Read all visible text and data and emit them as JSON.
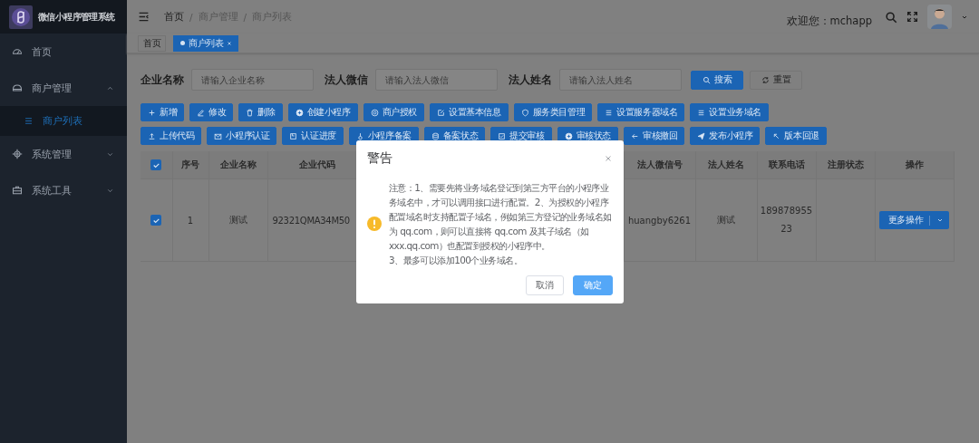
{
  "sidebar": {
    "title": "微信小程序管理系统",
    "items": [
      {
        "label": "首页",
        "selected": false
      },
      {
        "label": "商户管理",
        "selected": false,
        "expanded": true,
        "children": [
          {
            "label": "商户列表",
            "selected": true
          }
        ]
      },
      {
        "label": "系统管理",
        "selected": false,
        "expanded": false
      },
      {
        "label": "系统工具",
        "selected": false,
        "expanded": false
      }
    ]
  },
  "header": {
    "breadcrumb": [
      "首页",
      "商户管理",
      "商户列表"
    ],
    "separator": "/",
    "welcome": "欢迎您：mchapp"
  },
  "tags": [
    {
      "label": "首页",
      "selected": false
    },
    {
      "label": "商户列表",
      "selected": true
    }
  ],
  "search": {
    "fields": [
      {
        "label": "企业名称",
        "placeholder": "请输入企业名称"
      },
      {
        "label": "法人微信",
        "placeholder": "请输入法人微信"
      },
      {
        "label": "法人姓名",
        "placeholder": "请输入法人姓名"
      }
    ],
    "buttons": [
      {
        "label": "搜索",
        "kind": "primary"
      },
      {
        "label": "重置",
        "kind": "default"
      }
    ]
  },
  "toolbar": {
    "rows": [
      {
        "buttons": [
          "新增",
          "修改",
          "删除",
          "创建小程序",
          "商户授权",
          "设置基本信息",
          "服务类目管理",
          "设置服务器域名",
          "设置业务域名"
        ]
      },
      {
        "buttons": [
          "上传代码",
          "小程序认证",
          "认证进度",
          "小程序备案",
          "备案状态",
          "提交审核",
          "审核状态",
          "审核撤回",
          "发布小程序",
          "版本回退"
        ]
      }
    ]
  },
  "table": {
    "header_checked": true,
    "columns": [
      "序号",
      "企业名称",
      "企业代码",
      "法人微信号",
      "法人姓名",
      "联系电话",
      "注册状态",
      "操作"
    ],
    "rows": [
      {
        "selected": true,
        "index": "1",
        "company": "测试",
        "code": "92321QMA34M50",
        "wechat": "huangby6261",
        "legal_name": "测试",
        "phone": "18987895523",
        "action": "更多操作"
      }
    ]
  },
  "dialog": {
    "title": "警告",
    "message": "注意：1、需要先将业务域名登记到第三方平台的小程序业务域名中，才可以调用接口进行配置。2、为授权的小程序配置域名时支持配置子域名，例如第三方登记的业务域名如为 qq.com，则可以直接将 qq.com 及其子域名（如 xxx.qq.com）也配置到授权的小程序中。\n3、最多可以添加100个业务域名。",
    "buttons": [
      {
        "label": "取消",
        "kind": "default"
      },
      {
        "label": "确定",
        "kind": "primary"
      }
    ]
  }
}
